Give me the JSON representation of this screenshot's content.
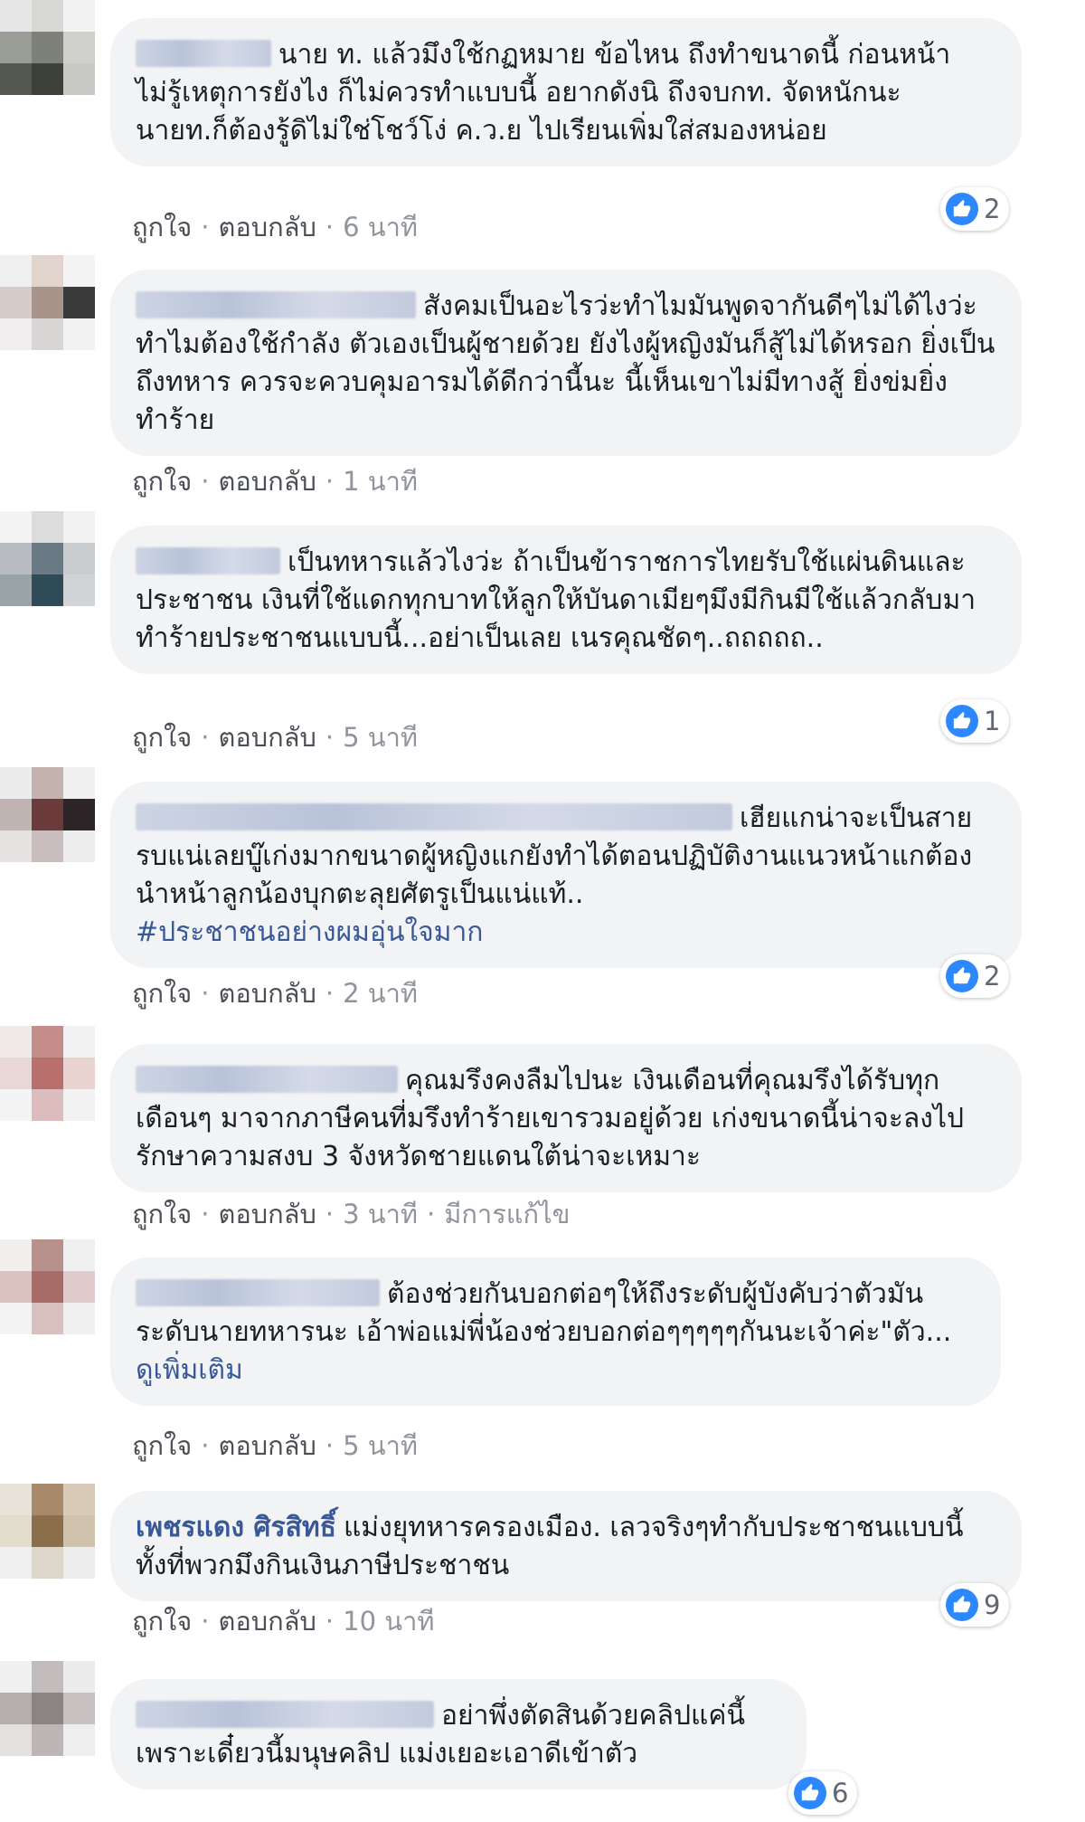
{
  "actions": {
    "like": "ถูกใจ",
    "reply": "ตอบกลับ",
    "separator": "·"
  },
  "comments": [
    {
      "name": "",
      "text": "นาย ท. แล้วมึงใช้กฏหมาย ข้อไหน ถึงทำขนาดนี้ ก่อนหน้าไม่รู้เหตุการยังไง ก็ไม่ควรทำแบบนี้ อยากดังนิ ถึงจบกท. จัดหนักนะ นายท.ก็ต้องรู้ดิไม่ใช่โชว์โง่ ค.ว.ย ไปเรียนเพิ่มใส่สมองหน่อย",
      "time": "6 นาที",
      "reactions": "2",
      "avatar_colors": [
        "#e6e6e6",
        "#d7d7d3",
        "#f2f2f2",
        "#9a9d96",
        "#7e8178",
        "#cfd0cc",
        "#55584f",
        "#3e4138",
        "#c8c9c4"
      ]
    },
    {
      "name": "",
      "text": "สังคมเป็นอะไรว่ะทำไมมันพูดจากันดีๆไม่ได้ไงว่ะ ทำไมต้องใช้กำลัง ตัวเองเป็นผู้ชายด้วย ยังไงผู้หญิงมันก็สู้ไม่ได้หรอก ยิ่งเป็นถึงทหาร ควรจะควบคุมอารมได้ดีกว่านี้นะ นี้เห็นเขาไม่มีทางสู้ ยิ่งข่มยิ่งทำร้าย",
      "time": "1 นาที",
      "reactions": "",
      "avatar_colors": [
        "#f0f0f0",
        "#e0d4cc",
        "#f4f4f4",
        "#d6cbc6",
        "#a9948a",
        "#3a3a3a",
        "#f0eeee",
        "#d9d5d4",
        "#f2f2f2"
      ]
    },
    {
      "name": "",
      "text": "เป็นทหารแล้วไงว่ะ ถ้าเป็นข้าราชการไทยรับใช้แผ่นดินและประชาชน เงินที่ใช้แดกทุกบาทให้ลูกให้บันดาเมียๆมึงมีกินมีใช้แล้วกลับมาทำร้ายประชาชนแบบนี้...อย่าเป็นเลย เนรคุณชัดๆ..ถถถถถ..",
      "time": "5 นาที",
      "reactions": "1",
      "avatar_colors": [
        "#f4f4f4",
        "#dcdcdc",
        "#f2f2f2",
        "#b8bcc0",
        "#6a7a84",
        "#c9cdd0",
        "#9aa4a8",
        "#2f4b58",
        "#d0d4d6"
      ]
    },
    {
      "name": "",
      "text": "เฮียแกน่าจะเป็นสายรบแน่เลยบู๊เก่งมากขนาดผู้หญิงแกยังทำได้ตอนปฏิบัติงานแนวหน้าแกต้องนำหน้าลูกน้องบุกตะลุยศัตรูเป็นแน่แท้..",
      "hashtag": "#ประชาชนอย่างผมอุ่นใจมาก",
      "time": "2 นาที",
      "reactions": "2",
      "avatar_colors": [
        "#ececec",
        "#c4b2ae",
        "#f0f0f0",
        "#bfb4b2",
        "#6b3a3a",
        "#2c2426",
        "#e6e2e2",
        "#c9bdbd",
        "#ededed"
      ]
    },
    {
      "name": "",
      "text": "คุณมรึงคงลืมไปนะ เงินเดือนที่คุณมรึงได้รับทุกเดือนๆ มาจากภาษีคนที่มรึงทำร้ายเขารวมอยู่ด้วย เก่งขนาดนี้น่าจะลงไปรักษาความสงบ 3 จังหวัดชายแดนใต้น่าจะเหมาะ",
      "time": "3 นาที",
      "edited": "มีการแก้ไข",
      "reactions": "",
      "avatar_colors": [
        "#f0eaea",
        "#c48d8a",
        "#f2f2f2",
        "#e9d6d6",
        "#b8706c",
        "#ead4d2",
        "#f4f4f4",
        "#dcbcbc",
        "#f2f2f2"
      ]
    },
    {
      "name": "",
      "text": "ต้องช่วยกันบอกต่อๆให้ถึงระดับผู้บังคับว่าตัวมันระดับนายทหารนะ เอ้าพ่อแม่พี่น้องช่วยบอกต่อๆๆๆๆๆกันนะเจ้าค่ะ\"ตัว...",
      "see_more": "ดูเพิ่มเติม",
      "time": "5 นาที",
      "reactions": "",
      "avatar_colors": [
        "#f2eeee",
        "#b8908c",
        "#f0f0f0",
        "#d9c2c0",
        "#a86c68",
        "#e2cccb",
        "#f4f4f4",
        "#d8c0be",
        "#f0f0f0"
      ]
    },
    {
      "name": "เพชรแดง ศิรสิทธิ์",
      "text": "แม่งยุทหารครองเมือง. เลวจริงๆทำกับประชาชนแบบนี้ ทั้งที่พวกมึงกินเงินภาษีประชาชน",
      "time": "10 นาที",
      "reactions": "9",
      "avatar_colors": [
        "#e8e2d8",
        "#a88a6a",
        "#d9cbb8",
        "#e2dccd",
        "#8a6f4a",
        "#cfc3ad",
        "#f0f0f0",
        "#dcd6cb",
        "#ededed"
      ]
    },
    {
      "name": "",
      "text": "อย่าพึ่งตัดสินด้วยคลิปแค่นี้เพราะเดี๋ยวนี้มนุษคลิป แม่งเยอะเอาดีเข้าตัว",
      "time": "",
      "reactions": "6",
      "avatar_colors": [
        "#f0f0f0",
        "#c2bcbc",
        "#ececec",
        "#b4aeae",
        "#8c8484",
        "#c6c0c0",
        "#e4e0e0",
        "#bcb6b6",
        "#eeeeee"
      ]
    }
  ]
}
